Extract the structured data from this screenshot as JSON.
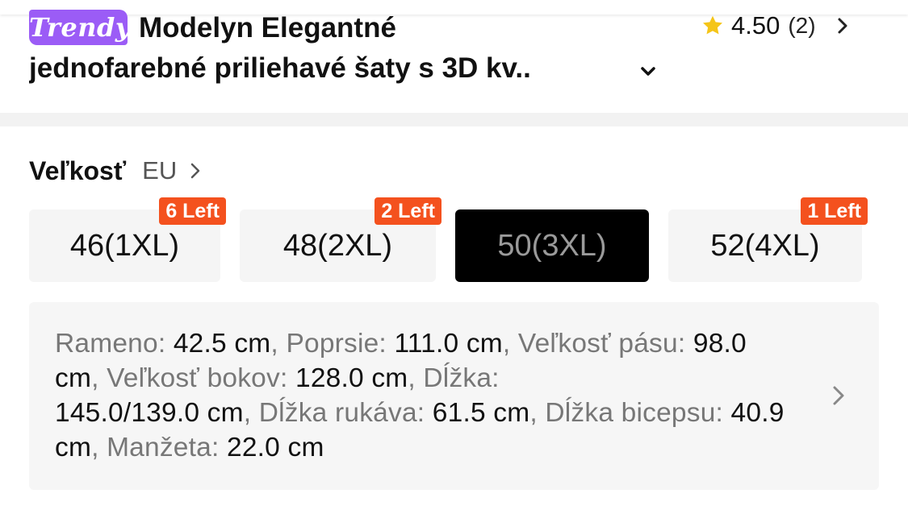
{
  "product": {
    "brand_badge": "Trendy",
    "title_line1": "Modelyn Elegantné",
    "title_line2": "jednofarebné priliehavé šaty s 3D kv..",
    "rating": {
      "value": "4.50",
      "count": "(2)"
    }
  },
  "size_section": {
    "label": "Veľkosť",
    "system": "EU",
    "options": [
      {
        "label": "46(1XL)",
        "stock": "6 Left",
        "selected": false
      },
      {
        "label": "48(2XL)",
        "stock": "2 Left",
        "selected": false
      },
      {
        "label": "50(3XL)",
        "stock": "",
        "selected": true
      },
      {
        "label": "52(4XL)",
        "stock": "1 Left",
        "selected": false
      }
    ]
  },
  "measurements": [
    {
      "name": "Rameno: ",
      "value": "42.5 cm"
    },
    {
      "name": "Poprsie: ",
      "value": "111.0 cm"
    },
    {
      "name": "Veľkosť pásu: ",
      "value": "98.0 cm"
    },
    {
      "name": "Veľkosť bokov: ",
      "value": "128.0 cm"
    },
    {
      "name": "Dĺžka: ",
      "value": "145.0/139.0 cm"
    },
    {
      "name": "Dĺžka rukáva: ",
      "value": "61.5 cm"
    },
    {
      "name": "Dĺžka bicepsu: ",
      "value": "40.9 cm"
    },
    {
      "name": "Manžeta: ",
      "value": "22.0 cm"
    }
  ],
  "measurement_separator": ", ",
  "colors": {
    "brand": "#9b5cf6",
    "star": "#f5c518",
    "stock_badge": "#f4511e",
    "selected_bg": "#000000"
  },
  "icons": {
    "star": "star-icon",
    "rating_arrow": "chevron-right-icon",
    "expand_title": "chevron-down-icon",
    "size_guide": "chevron-right-icon",
    "measurements_arrow": "chevron-right-icon"
  }
}
